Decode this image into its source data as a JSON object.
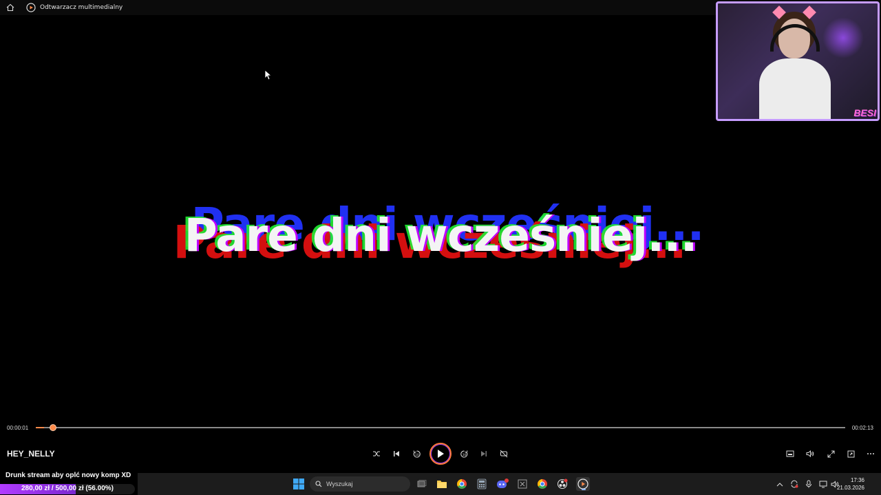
{
  "window": {
    "title": "Odtwarzacz multimedialny",
    "home_icon": "home-icon",
    "app_icon": "media-player-icon"
  },
  "video": {
    "caption": "Pare dni wcześniej..."
  },
  "webcam": {
    "logo_text": "BESI",
    "border_color": "#c69cff"
  },
  "player": {
    "current_time": "00:00:01",
    "total_time": "00:02:13",
    "progress_fraction": 0.01,
    "media_title": "HEY_NELLY",
    "accent_color": "#ff8a4a",
    "controls": {
      "shuffle": "shuffle-icon",
      "previous": "previous-icon",
      "rewind": "rewind-10-icon",
      "play": "play-icon",
      "forward": "forward-30-icon",
      "next": "next-icon",
      "repeat": "repeat-off-icon",
      "miniplayer": "miniplayer-icon",
      "volume": "volume-icon",
      "fullscreen": "fullscreen-icon",
      "cast": "cast-icon",
      "more": "more-icon"
    }
  },
  "goal": {
    "title": "Drunk stream aby oplć nowy komp XD",
    "amount_text": "280,00 zł  /  500,00 zł (56.00%)",
    "fraction": 0.56,
    "fill_color": "#b23cff"
  },
  "taskbar": {
    "search_placeholder": "Wyszukaj",
    "time": "17:36",
    "date": "21.03.2026"
  }
}
